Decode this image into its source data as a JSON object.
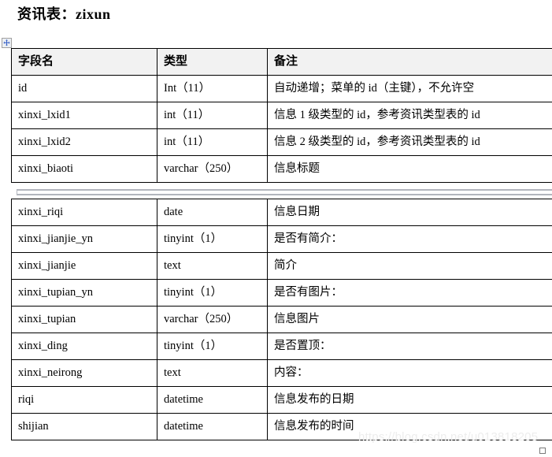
{
  "document": {
    "title": "资讯表：zixun",
    "watermark": "https://blog.csdn.net/u013818205"
  },
  "handles": {
    "move_icon": "move-cross-icon",
    "resize_icon": "resize-handle-icon"
  },
  "table": {
    "columns": [
      {
        "key": "field",
        "label": "字段名"
      },
      {
        "key": "type",
        "label": "类型"
      },
      {
        "key": "remark",
        "label": "备注"
      }
    ],
    "part1_rows": [
      {
        "field": "id",
        "type": "Int（11）",
        "remark": "自动递增；菜单的 id（主键），不允许空"
      },
      {
        "field": "xinxi_lxid1",
        "type": "int（11）",
        "remark": "信息 1 级类型的 id，参考资讯类型表的 id"
      },
      {
        "field": "xinxi_lxid2",
        "type": "int（11）",
        "remark": "信息 2 级类型的 id，参考资讯类型表的 id"
      },
      {
        "field": "xinxi_biaoti",
        "type": "varchar（250）",
        "remark": "信息标题"
      }
    ],
    "part2_rows": [
      {
        "field": "xinxi_riqi",
        "type": "date",
        "remark": "信息日期"
      },
      {
        "field": "xinxi_jianjie_yn",
        "type": "tinyint（1）",
        "remark": "是否有简介："
      },
      {
        "field": "xinxi_jianjie",
        "type": "text",
        "remark": "简介"
      },
      {
        "field": "xinxi_tupian_yn",
        "type": "tinyint（1）",
        "remark": "是否有图片："
      },
      {
        "field": "xinxi_tupian",
        "type": "varchar（250）",
        "remark": "信息图片"
      },
      {
        "field": "xinxi_ding",
        "type": "tinyint（1）",
        "remark": "是否置顶："
      },
      {
        "field": "xinxi_neirong",
        "type": "text",
        "remark": "内容："
      },
      {
        "field": "riqi",
        "type": "datetime",
        "remark": "信息发布的日期"
      },
      {
        "field": "shijian",
        "type": "datetime",
        "remark": "信息发布的时间"
      }
    ]
  },
  "colors": {
    "header_bg": "#f2f2f2",
    "border": "#000000",
    "page_break": "#b2b5bd",
    "watermark": "#ededed",
    "move_handle_arrow": "#3a63c8"
  }
}
